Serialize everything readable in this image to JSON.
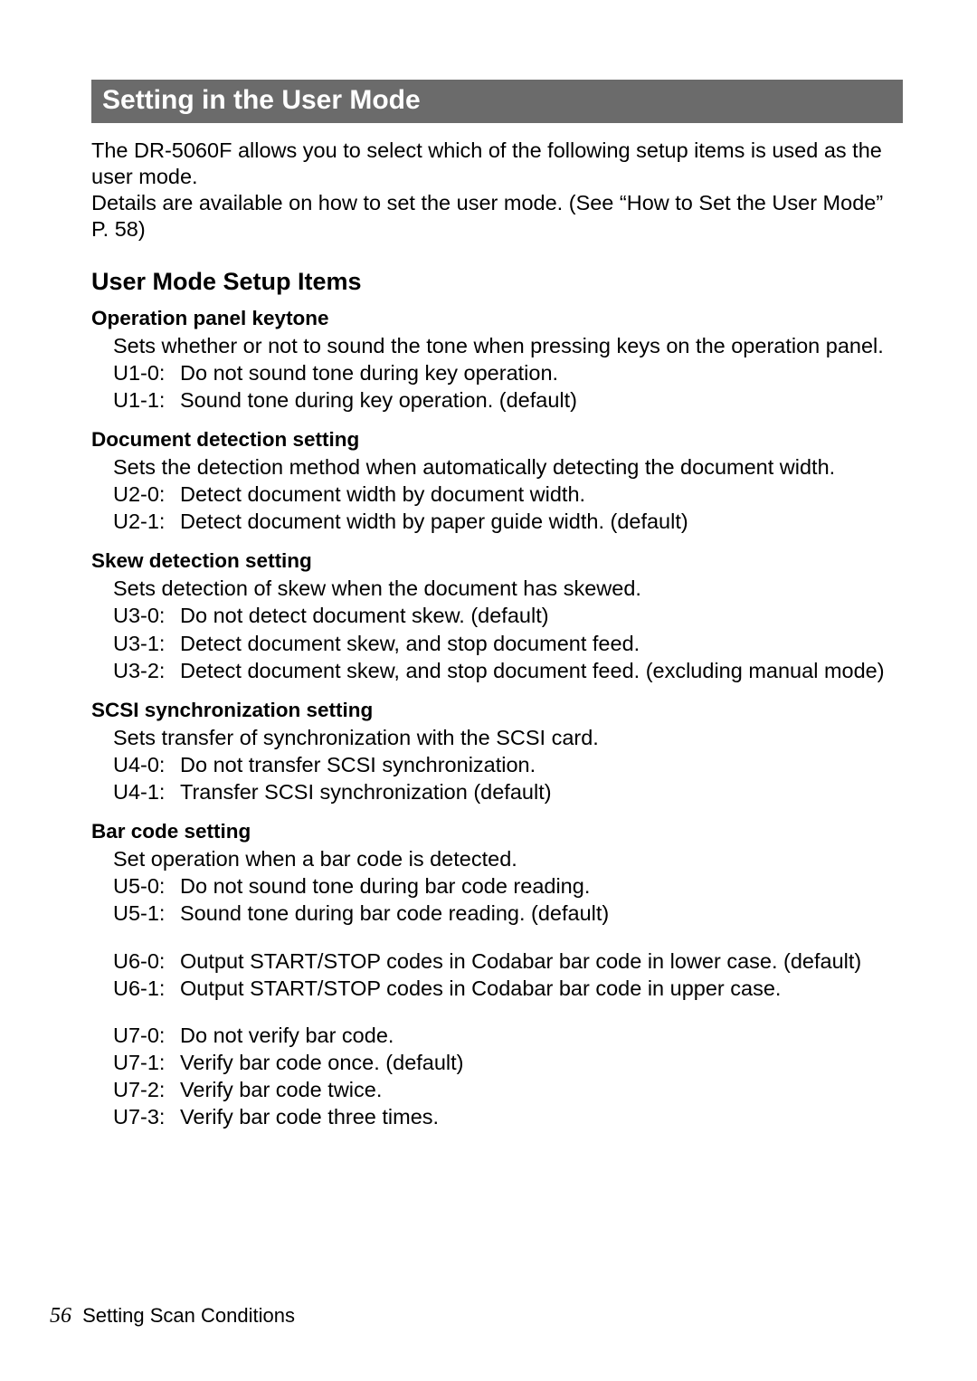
{
  "mainHeading": "Setting in the User Mode",
  "intro": "The DR-5060F allows you to select which of the following setup items is used as the user mode.\nDetails are available on how to set the user mode. (See “How to Set the User Mode” P. 58)",
  "subHeading": "User Mode Setup Items",
  "sections": [
    {
      "title": "Operation panel keytone",
      "desc": "Sets whether or not to sound the tone when pressing keys on the operation panel.",
      "lines": [
        {
          "code": "U1-0:",
          "text": "Do not sound tone during key operation."
        },
        {
          "code": "U1-1:",
          "text": "Sound tone during key operation. (default)"
        }
      ]
    },
    {
      "title": "Document detection setting",
      "desc": "Sets the detection method when automatically detecting the document width.",
      "lines": [
        {
          "code": "U2-0:",
          "text": "Detect document width by document width."
        },
        {
          "code": "U2-1:",
          "text": "Detect document width by paper guide width. (default)"
        }
      ]
    },
    {
      "title": "Skew detection setting",
      "desc": "Sets detection of skew when the document has skewed.",
      "lines": [
        {
          "code": "U3-0:",
          "text": "Do not detect document skew. (default)"
        },
        {
          "code": "U3-1:",
          "text": "Detect document skew, and stop document feed."
        },
        {
          "code": "U3-2:",
          "text": "Detect document skew, and stop document feed. (excluding manual mode)"
        }
      ]
    },
    {
      "title": "SCSI synchronization setting",
      "desc": "Sets transfer of synchronization with the SCSI card.",
      "lines": [
        {
          "code": "U4-0:",
          "text": "Do not transfer SCSI synchronization."
        },
        {
          "code": "U4-1:",
          "text": "Transfer SCSI synchronization (default)"
        }
      ]
    },
    {
      "title": "Bar code setting",
      "desc": "Set operation when a bar code is detected.",
      "groups": [
        [
          {
            "code": "U5-0:",
            "text": "Do not sound tone during bar code reading."
          },
          {
            "code": "U5-1:",
            "text": "Sound tone during bar code reading. (default)"
          }
        ],
        [
          {
            "code": "U6-0:",
            "text": "Output START/STOP codes in Codabar bar code in lower case. (default)"
          },
          {
            "code": "U6-1:",
            "text": "Output START/STOP codes in Codabar bar code in upper case."
          }
        ],
        [
          {
            "code": "U7-0:",
            "text": "Do not verify bar code."
          },
          {
            "code": "U7-1:",
            "text": "Verify bar code once. (default)"
          },
          {
            "code": "U7-2:",
            "text": "Verify bar code twice."
          },
          {
            "code": "U7-3:",
            "text": "Verify bar code three times."
          }
        ]
      ]
    }
  ],
  "footer": {
    "pageNumber": "56",
    "text": "Setting Scan Conditions"
  }
}
